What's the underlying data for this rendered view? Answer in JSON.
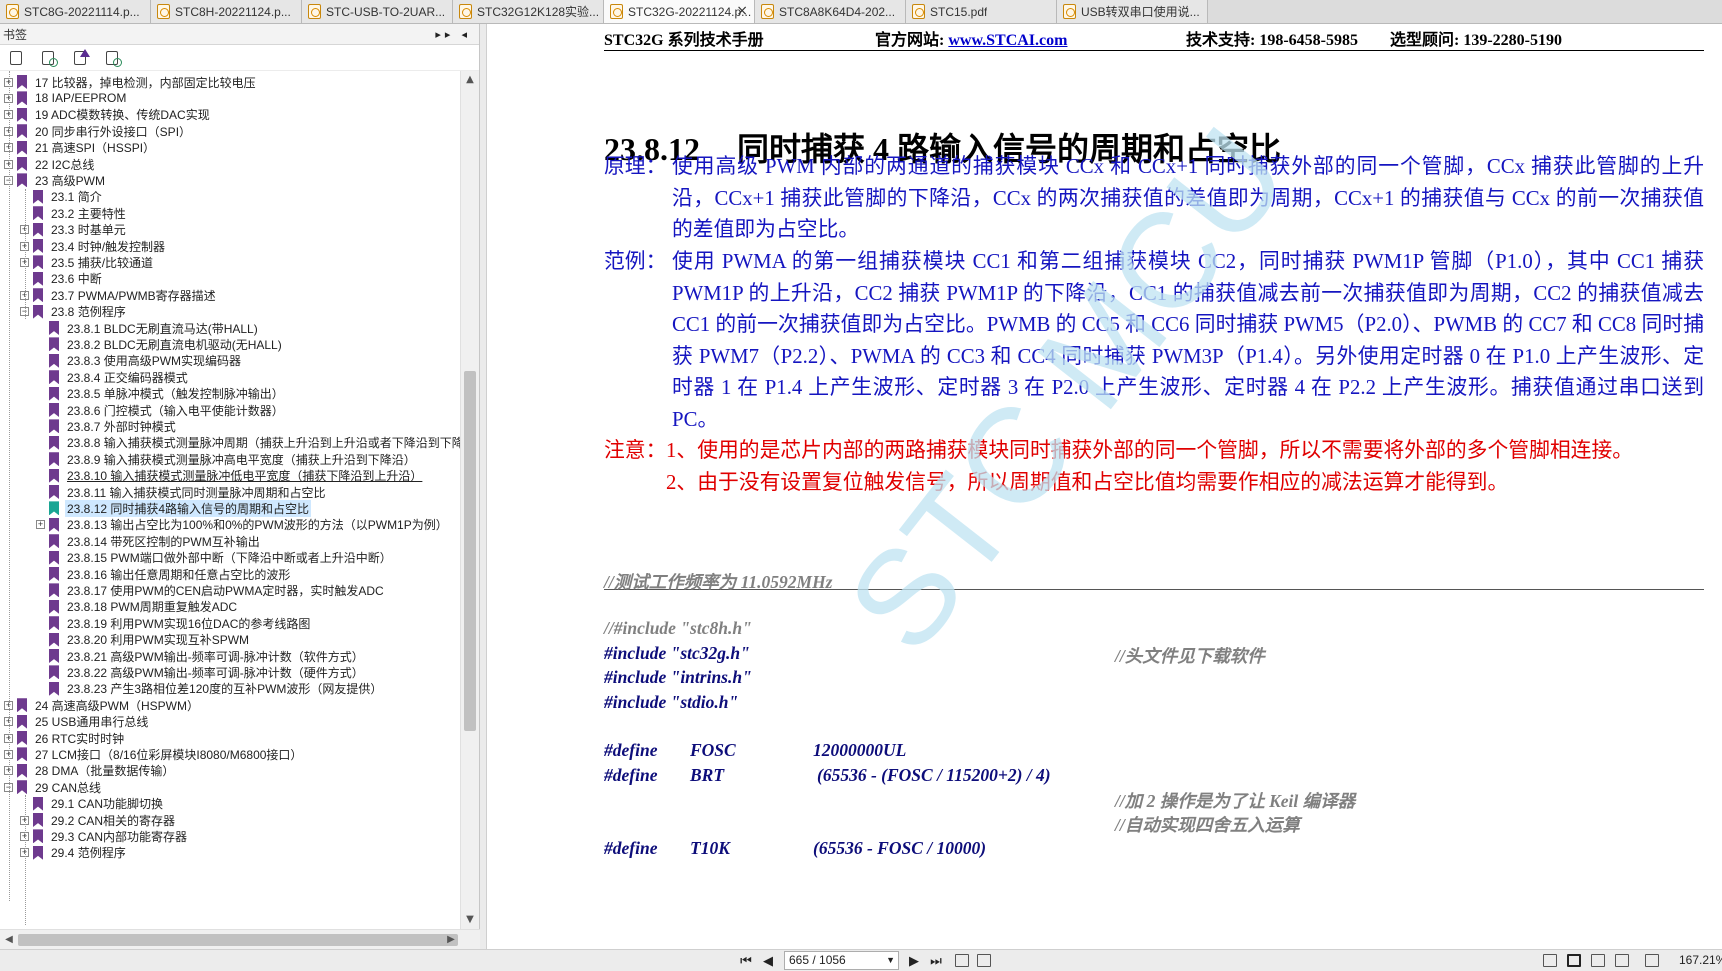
{
  "tabs": [
    {
      "label": "STC8G-20221114.p...",
      "active": false
    },
    {
      "label": "STC8H-20221124.p...",
      "active": false
    },
    {
      "label": "STC-USB-TO-2UAR...",
      "active": false
    },
    {
      "label": "STC32G12K128实验...",
      "active": false
    },
    {
      "label": "STC32G-20221124.p...",
      "active": true,
      "close": "×"
    },
    {
      "label": "STC8A8K64D4-202...",
      "active": false
    },
    {
      "label": "STC15.pdf",
      "active": false
    },
    {
      "label": "USB转双串口使用说...",
      "active": false
    }
  ],
  "sidebar": {
    "title": "书签",
    "controls": "▸▸ ◂",
    "tools": [
      "expand-bookmark-icon",
      "collapse-bookmark-icon",
      "add-bookmark-icon",
      "find-bookmark-icon"
    ],
    "items": [
      {
        "level": 0,
        "exp": "+",
        "label": "17 比较器，掉电检测，内部固定比较电压"
      },
      {
        "level": 0,
        "exp": "+",
        "label": "18 IAP/EEPROM"
      },
      {
        "level": 0,
        "exp": "+",
        "label": "19 ADC模数转换、传统DAC实现"
      },
      {
        "level": 0,
        "exp": "+",
        "label": "20 同步串行外设接口（SPI）"
      },
      {
        "level": 0,
        "exp": "+",
        "label": "21 高速SPI（HSSPI）"
      },
      {
        "level": 0,
        "exp": "+",
        "label": "22 I2C总线"
      },
      {
        "level": 0,
        "exp": "−",
        "label": "23 高级PWM"
      },
      {
        "level": 1,
        "exp": "",
        "label": "23.1 简介"
      },
      {
        "level": 1,
        "exp": "",
        "label": "23.2 主要特性"
      },
      {
        "level": 1,
        "exp": "+",
        "label": "23.3 时基单元"
      },
      {
        "level": 1,
        "exp": "+",
        "label": "23.4 时钟/触发控制器"
      },
      {
        "level": 1,
        "exp": "+",
        "label": "23.5 捕获/比较通道"
      },
      {
        "level": 1,
        "exp": "",
        "label": "23.6 中断"
      },
      {
        "level": 1,
        "exp": "+",
        "label": "23.7 PWMA/PWMB寄存器描述"
      },
      {
        "level": 1,
        "exp": "−",
        "label": "23.8 范例程序"
      },
      {
        "level": 2,
        "exp": "",
        "label": "23.8.1 BLDC无刷直流马达(带HALL)"
      },
      {
        "level": 2,
        "exp": "",
        "label": "23.8.2 BLDC无刷直流电机驱动(无HALL)"
      },
      {
        "level": 2,
        "exp": "",
        "label": "23.8.3 使用高级PWM实现编码器"
      },
      {
        "level": 2,
        "exp": "",
        "label": "23.8.4 正交编码器模式"
      },
      {
        "level": 2,
        "exp": "",
        "label": "23.8.5 单脉冲模式（触发控制脉冲输出）"
      },
      {
        "level": 2,
        "exp": "",
        "label": "23.8.6 门控模式（输入电平使能计数器）"
      },
      {
        "level": 2,
        "exp": "",
        "label": "23.8.7 外部时钟模式"
      },
      {
        "level": 2,
        "exp": "",
        "label": "23.8.8 输入捕获模式测量脉冲周期（捕获上升沿到上升沿或者下降沿到下降沿）"
      },
      {
        "level": 2,
        "exp": "",
        "label": "23.8.9 输入捕获模式测量脉冲高电平宽度（捕获上升沿到下降沿）"
      },
      {
        "level": 2,
        "exp": "",
        "label": "23.8.10 输入捕获模式测量脉冲低电平宽度（捕获下降沿到上升沿）",
        "underline": true
      },
      {
        "level": 2,
        "exp": "",
        "label": "23.8.11 输入捕获模式同时测量脉冲周期和占空比"
      },
      {
        "level": 2,
        "exp": "",
        "label": "23.8.12 同时捕获4路输入信号的周期和占空比",
        "selected": true
      },
      {
        "level": 2,
        "exp": "+",
        "label": "23.8.13 输出占空比为100%和0%的PWM波形的方法（以PWM1P为例）"
      },
      {
        "level": 2,
        "exp": "",
        "label": "23.8.14 带死区控制的PWM互补输出"
      },
      {
        "level": 2,
        "exp": "",
        "label": "23.8.15 PWM端口做外部中断（下降沿中断或者上升沿中断）"
      },
      {
        "level": 2,
        "exp": "",
        "label": "23.8.16 输出任意周期和任意占空比的波形"
      },
      {
        "level": 2,
        "exp": "",
        "label": "23.8.17 使用PWM的CEN启动PWMA定时器，实时触发ADC"
      },
      {
        "level": 2,
        "exp": "",
        "label": "23.8.18 PWM周期重复触发ADC"
      },
      {
        "level": 2,
        "exp": "",
        "label": "23.8.19 利用PWM实现16位DAC的参考线路图"
      },
      {
        "level": 2,
        "exp": "",
        "label": "23.8.20 利用PWM实现互补SPWM"
      },
      {
        "level": 2,
        "exp": "",
        "label": "23.8.21 高级PWM输出-频率可调-脉冲计数（软件方式）"
      },
      {
        "level": 2,
        "exp": "",
        "label": "23.8.22 高级PWM输出-频率可调-脉冲计数（硬件方式）"
      },
      {
        "level": 2,
        "exp": "",
        "label": "23.8.23 产生3路相位差120度的互补PWM波形（网友提供）"
      },
      {
        "level": 0,
        "exp": "+",
        "label": "24 高速高级PWM（HSPWM）"
      },
      {
        "level": 0,
        "exp": "+",
        "label": "25 USB通用串行总线"
      },
      {
        "level": 0,
        "exp": "+",
        "label": "26 RTC实时时钟"
      },
      {
        "level": 0,
        "exp": "+",
        "label": "27 LCM接口（8/16位彩屏模块I8080/M6800接口）"
      },
      {
        "level": 0,
        "exp": "+",
        "label": "28 DMA（批量数据传输）"
      },
      {
        "level": 0,
        "exp": "−",
        "label": "29 CAN总线"
      },
      {
        "level": 1,
        "exp": "",
        "label": "29.1 CAN功能脚切换"
      },
      {
        "level": 1,
        "exp": "+",
        "label": "29.2 CAN相关的寄存器"
      },
      {
        "level": 1,
        "exp": "+",
        "label": "29.3   CAN内部功能寄存器"
      },
      {
        "level": 1,
        "exp": "+",
        "label": "29.4 范例程序"
      }
    ]
  },
  "doc": {
    "header": {
      "manual": "STC32G 系列技术手册",
      "site_label": "官方网站: ",
      "site_link": "www.STCAI.com",
      "support": "技术支持: 198-6458-5985",
      "advisor": "选型顾问: 139-2280-5190"
    },
    "section_number": "23.8.12",
    "section_title": "同时捕获 4 路输入信号的周期和占空比",
    "principle_label": "原理：",
    "principle": "使用高级 PWM 内部的两通道的捕获模块 CCx 和 CCx+1 同时捕获外部的同一个管脚，CCx 捕获此管脚的上升沿，CCx+1 捕获此管脚的下降沿，CCx 的两次捕获值的差值即为周期，CCx+1 的捕获值与 CCx 的前一次捕获值的差值即为占空比。",
    "example_label": "范例：",
    "example": "使用 PWMA 的第一组捕获模块 CC1 和第二组捕获模块 CC2，同时捕获 PWM1P 管脚（P1.0），其中 CC1 捕获 PWM1P 的上升沿，CC2 捕获 PWM1P 的下降沿，CC1 的捕获值减去前一次捕获值即为周期，CC2 的捕获值减去 CC1 的前一次捕获值即为占空比。PWMB 的 CC5 和 CC6 同时捕获 PWM5（P2.0）、PWMB 的 CC7 和 CC8 同时捕获 PWM7（P2.2）、PWMA 的 CC3 和 CC4 同时捕获 PWM3P（P1.4）。另外使用定时器 0 在 P1.0 上产生波形、定时器 1 在 P1.4 上产生波形、定时器 3 在 P2.0 上产生波形、定时器 4 在 P2.2 上产生波形。捕获值通过串口送到 PC。",
    "note_label": "注意：",
    "note1": "1、使用的是芯片内部的两路捕获模块同时捕获外部的同一个管脚，所以不需要将外部的多个管脚相连接。",
    "note2": "2、由于没有设置复位触发信号，所以周期值和占空比值均需要作相应的减法运算才能得到。",
    "code": {
      "comment_freq": "//测试工作频率为 11.0592MHz",
      "inc_stc8h": "//#include \"stc8h.h\"",
      "inc_stc32g": "#include \"stc32g.h\"",
      "inc_comment": "//头文件见下载软件",
      "inc_intrins": "#include \"intrins.h\"",
      "inc_stdio": "#include \"stdio.h\"",
      "def_kw": "#define",
      "fosc_name": "FOSC",
      "fosc_val": "12000000UL",
      "brt_name": "BRT",
      "brt_val": "(65536 - (FOSC / 115200+2) / 4)",
      "cmt_plus2": "//加 2 操作是为了让 Keil 编译器",
      "cmt_round": "//自动实现四舍五入运算",
      "t10k_name": "T10K",
      "t10k_val": "(65536 - FOSC / 10000)"
    },
    "watermark": "STC MCU"
  },
  "status": {
    "page": "665 / 1056",
    "zoom": "167.21%"
  },
  "colors": {
    "blue_text": "#1515c0",
    "red_text": "#e00000",
    "bookmark": "#6e3a8e",
    "bookmark_selected": "#1aa593"
  }
}
